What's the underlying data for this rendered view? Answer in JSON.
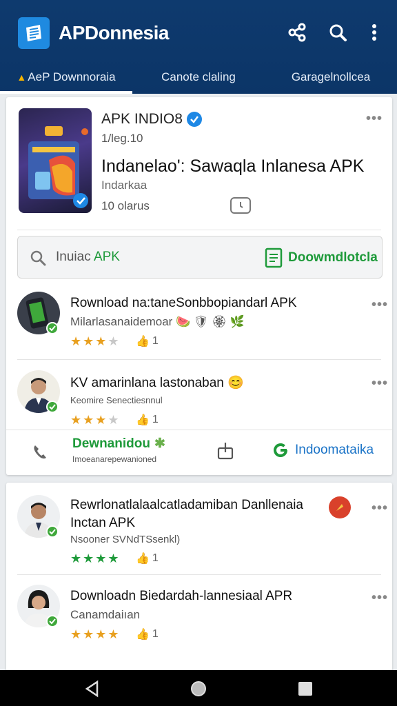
{
  "header": {
    "app_title": "APDonnesia",
    "icons": [
      "share-icon",
      "search-icon",
      "more-vertical-icon"
    ],
    "tabs": [
      {
        "label": "AeP Downnoraia",
        "active": true
      },
      {
        "label": "Canote claling",
        "active": false
      },
      {
        "label": "Garagelnollcea",
        "active": false
      }
    ]
  },
  "featured": {
    "title": "APK INDIO8",
    "version": "1/leg.10",
    "name": "Indanelao': Sawaqla Inlanesa APK",
    "category": "Indarkaa",
    "count": "10 olarus"
  },
  "search": {
    "query_prefix": "Inuiac ",
    "query_suffix": "APK",
    "download_label": "Doowmdlotcla"
  },
  "items": [
    {
      "title": "Rownload na:taneSonbbopiandarl APK",
      "subtitle": "Milarlasanaidemoar",
      "likes": "1",
      "rating": 3
    },
    {
      "title": "KV amarinlana lastonaban",
      "subtitle": "Keomire Senectiesnnul",
      "likes": "1",
      "rating": 3
    },
    {
      "title": "Rewrlonatlalaalcatladamiban Danllenaia Inctan APK",
      "subtitle": "Nsooner SVNdTSsenkl)",
      "likes": "1",
      "rating": 4
    },
    {
      "title": "Downloadn Biedardah-lannesiaal APR",
      "subtitle": "Canamdaiıan",
      "likes": "1",
      "rating": 4
    }
  ],
  "actions": {
    "download_label": "Dewnanidou",
    "download_sub": "Imoeanarepewanioned",
    "indo_label": "Indoomataika"
  },
  "colors": {
    "header_bg": "#0c3567",
    "accent_green": "#1e9a3a",
    "accent_blue": "#1a73c7",
    "star": "#e8a020"
  }
}
